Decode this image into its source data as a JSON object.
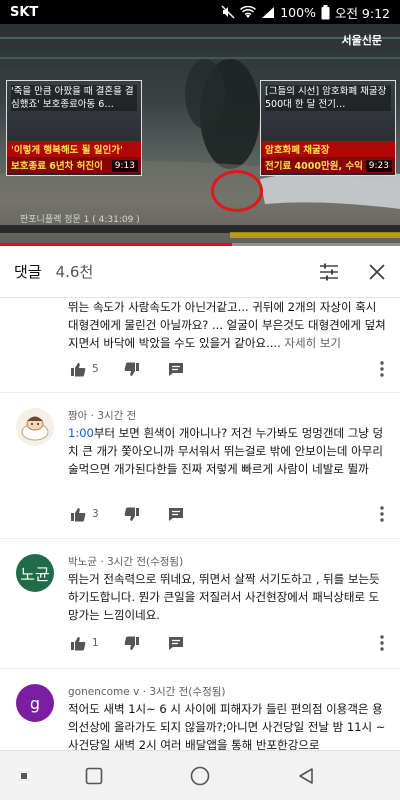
{
  "status_bar": {
    "carrier": "SKT",
    "battery": "100%",
    "time": "오전 9:12"
  },
  "video": {
    "brand": "서울신문",
    "cam_label": "판포니플렉 정문 1 ( 4:31:09 )",
    "progress": 0.58,
    "end_cards": [
      {
        "headline": "'죽을 만큼 아팠을 때 결혼을 결심했죠' 보호종료아동 6…",
        "caption1": "'이렇게 행복해도 될 일인가'",
        "caption2": "보호종료 6년차 허진이",
        "duration": "9:13"
      },
      {
        "headline": "[그들의 시선] 암호화폐 채굴장 500대 한 달 전기…",
        "caption1": "암호화폐 채굴장",
        "caption2": "전기료 4000만원, 수익",
        "duration": "9:23"
      }
    ]
  },
  "comments_header": {
    "title": "댓글",
    "count": "4.6천",
    "sort_icon": "sort-filter-icon",
    "close_icon": "close-icon"
  },
  "comments": [
    {
      "author": "",
      "time": "",
      "text": "뛰는 속도가 사람속도가 아닌거같고... 귀뒤에 2개의 자상이 혹시 대형견에게 물린건 아닐까요? ... 얼굴이 부은것도 대형견에게 덮쳐지면서 바닥에 박았을 수도 있을거 같아요....",
      "more": "자세히 보기",
      "likes": "5"
    },
    {
      "author": "짱아",
      "time": "3시간 전",
      "timestamp_link": "1:00",
      "text": "부터 보면 흰색이 개아니나? 저건 누가봐도 멍멍갠데 그냥 덩치 큰 개가 쫓아오니까 무서워서 뛰는걸로 밖에 안보이는데 아무리 술먹으면 개가된다한들 진짜 저렇게 빠르게 사람이 네발로 뛸까",
      "likes": "3"
    },
    {
      "author": "박노균",
      "time": "3시간 전(수정됨)",
      "avatar_text": "노균",
      "text": "뛰는거 전속력으로 뛰네요, 뛰면서 살짝 서기도하고 , 뒤를 보는듯 하기도합니다. 뭔가 큰일을 저질러서 사건현장에서 패닉상태로 도망가는 느낌이네요.",
      "likes": "1"
    },
    {
      "author": "gonencome v",
      "time": "3시간 전(수정됨)",
      "avatar_text": "g",
      "text": "적어도 새벽 1시~ 6 시 사이에 피해자가 들린 편의점  이용객은 용의선상에 올라가도 되지 않을까?;아니면  사건당일 전날 밤 11시 ~사건당일 새벽 2시 여러   배달앱을 통해 반포한강으로"
    }
  ],
  "colors": {
    "link": "#065fd4",
    "avatar_green": "#1f6b4a",
    "avatar_purple": "#7b1fa2",
    "progress_red": "#ff0000"
  }
}
